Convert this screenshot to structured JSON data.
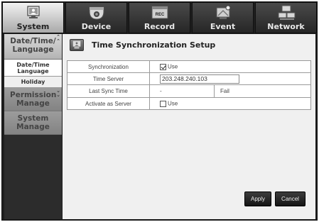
{
  "tabs": [
    {
      "label": "System",
      "icon": "system-icon"
    },
    {
      "label": "Device",
      "icon": "camera-icon"
    },
    {
      "label": "Record",
      "icon": "record-icon"
    },
    {
      "label": "Event",
      "icon": "event-icon"
    },
    {
      "label": "Network",
      "icon": "network-icon"
    }
  ],
  "tab_icon_text": {
    "record": "REC"
  },
  "sidebar": {
    "date_group": "Date/Time/ Language",
    "sub_items": [
      "Date/Time Language",
      "Holiday"
    ],
    "permission": "Permission Manage",
    "system": "System Manage"
  },
  "panel": {
    "title": "Time Synchronization Setup",
    "rows": {
      "sync_label": "Synchronization",
      "sync_use": "Use",
      "server_label": "Time Server",
      "server_value": "203.248.240.103",
      "last_label": "Last Sync Time",
      "last_value": "-",
      "last_status": "Fail",
      "activate_label": "Activate as Server",
      "activate_use": "Use"
    },
    "buttons": {
      "apply": "Apply",
      "cancel": "Cancel"
    }
  },
  "state": {
    "synchronization_checked": true,
    "activate_checked": false
  }
}
